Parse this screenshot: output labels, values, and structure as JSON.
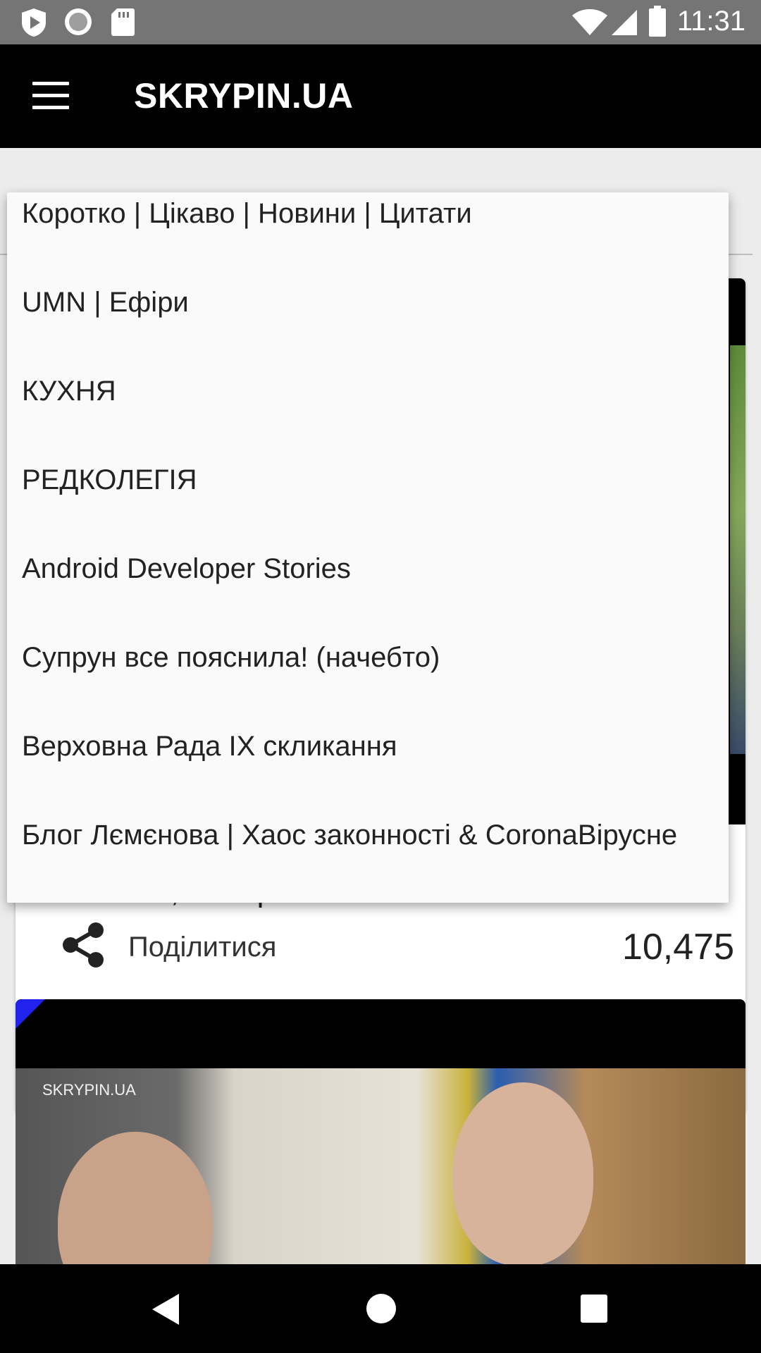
{
  "status_bar": {
    "time": "11:31",
    "left_icons": [
      "play-protect-icon",
      "record-icon",
      "sd-card-icon"
    ],
    "right_icons": [
      "wifi-icon",
      "signal-icon",
      "battery-icon"
    ]
  },
  "app_bar": {
    "title": "SKRYPIN.UA",
    "menu_icon": "hamburger-menu-icon"
  },
  "dropdown": {
    "items": [
      "Коротко | Цікаво | Новини | Цитати",
      "UMN | Ефіри",
      "КУХНЯ",
      "РЕДКОЛЕГІЯ",
      "Android Developer Stories",
      "Супрун все пояснила! (начебто)",
      "Верховна Рада IX скликання",
      "Блог Лємєнова | Хаос законності & CoronaВірусне"
    ]
  },
  "feed": {
    "card1": {
      "title_partial": "Головний, а Мер",
      "share_label": "Поділитися",
      "views": "10,475"
    },
    "card2": {
      "watermark": "SKRYPIN.UA"
    }
  },
  "nav_bar": {
    "back": "back-icon",
    "home": "home-icon",
    "recents": "recents-icon"
  },
  "colors": {
    "app_bar": "#000000",
    "status_bar": "#757575",
    "dropdown_bg": "#fafafa",
    "corner_accent": "#2222ee"
  }
}
